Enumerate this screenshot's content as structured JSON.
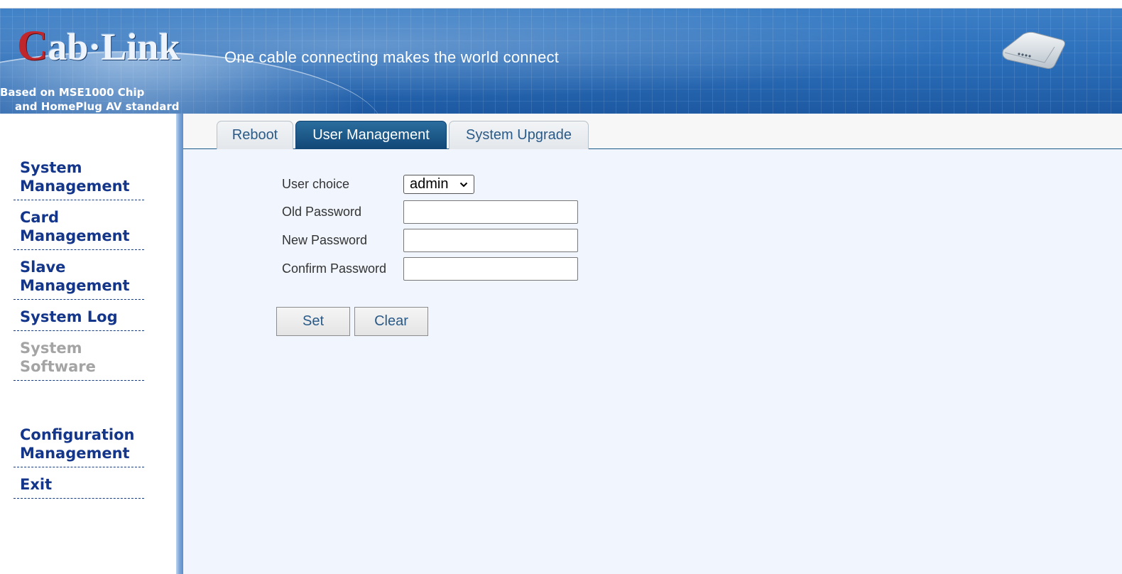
{
  "header": {
    "logo_initial": "C",
    "logo_rest": "ab·Link",
    "slogan": "One cable connecting makes the world connect",
    "chip_line1": "Based on MSE1000 Chip",
    "chip_line2": "and HomePlug AV standard"
  },
  "sidebar": {
    "items": [
      {
        "label": "System Management"
      },
      {
        "label": "Card Management"
      },
      {
        "label": "Slave Management"
      },
      {
        "label": "System Log"
      },
      {
        "label": "System Software"
      },
      {
        "label": "Configuration Management"
      },
      {
        "label": "Exit"
      }
    ]
  },
  "tabs": [
    {
      "label": "Reboot"
    },
    {
      "label": "User Management"
    },
    {
      "label": "System Upgrade"
    }
  ],
  "form": {
    "user_choice_label": "User choice",
    "user_choice_value": "admin",
    "old_password_label": "Old Password",
    "new_password_label": "New Password",
    "confirm_password_label": "Confirm Password",
    "old_password_value": "",
    "new_password_value": "",
    "confirm_password_value": ""
  },
  "buttons": {
    "set_label": "Set",
    "clear_label": "Clear"
  },
  "colors": {
    "nav_text": "#14368a",
    "nav_disabled": "#a4a4a4",
    "active_tab": "#114776",
    "content_bg": "#f1f6fe"
  }
}
